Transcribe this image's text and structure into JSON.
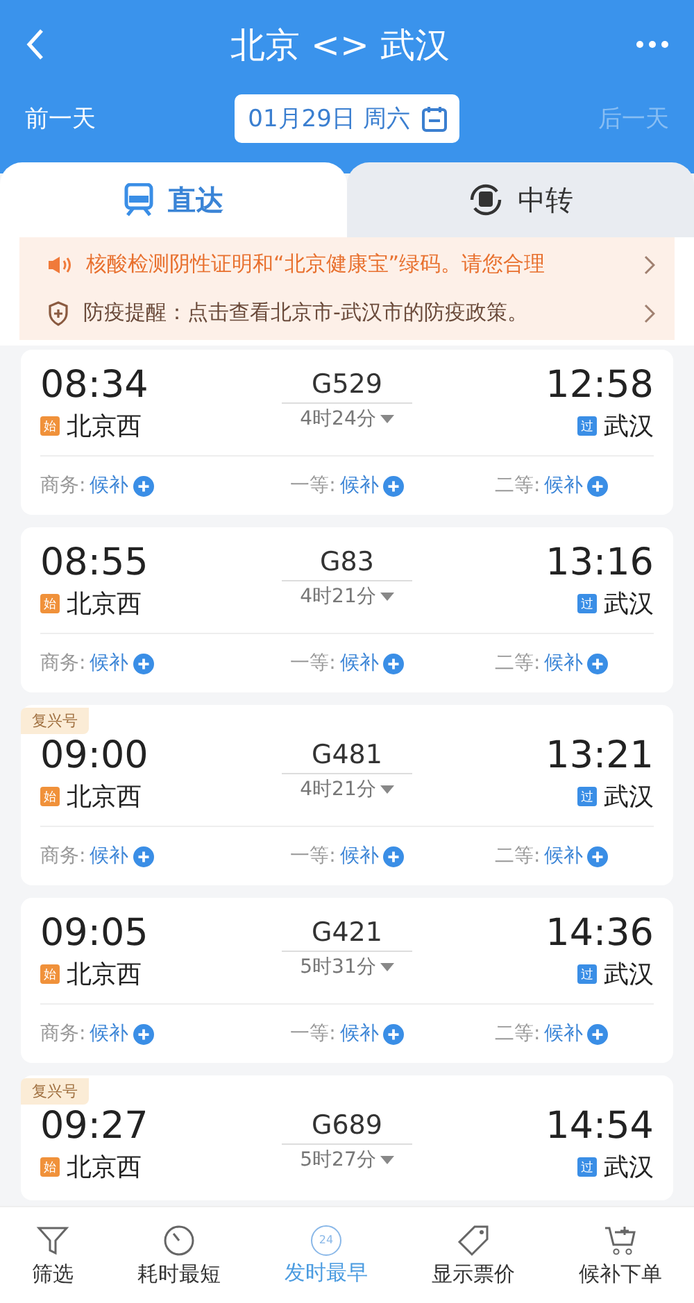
{
  "header": {
    "title": "北京 <> 武汉",
    "prev_day": "前一天",
    "date": "01月29日 周六",
    "next_day": "后一天",
    "next_day_disabled": true
  },
  "tabs": [
    {
      "label": "直达",
      "kind": "direct",
      "selected": true
    },
    {
      "label": "中转",
      "kind": "transfer",
      "selected": false
    }
  ],
  "notices": [
    {
      "kind": "speaker",
      "text": "核酸检测阴性证明和“北京健康宝”绿码。请您合理"
    },
    {
      "kind": "shield",
      "text": "防疫提醒：点击查看北京市-武汉市的防疫政策。"
    }
  ],
  "trains": [
    {
      "depart": "08:34",
      "origin": {
        "badge": "始",
        "color": "#f0913a",
        "name": "北京西"
      },
      "number": "G529",
      "duration": "4时24分",
      "arrive": "12:58",
      "destination": {
        "badge": "过",
        "color": "#3a8ee6",
        "name": "武汉"
      },
      "seats": [
        {
          "class": "商务:",
          "status": "候补"
        },
        {
          "class": "一等:",
          "status": "候补"
        },
        {
          "class": "二等:",
          "status": "候补"
        }
      ]
    },
    {
      "depart": "08:55",
      "origin": {
        "badge": "始",
        "color": "#f0913a",
        "name": "北京西"
      },
      "number": "G83",
      "duration": "4时21分",
      "arrive": "13:16",
      "destination": {
        "badge": "过",
        "color": "#3a8ee6",
        "name": "武汉"
      },
      "seats": [
        {
          "class": "商务:",
          "status": "候补"
        },
        {
          "class": "一等:",
          "status": "候补"
        },
        {
          "class": "二等:",
          "status": "候补"
        }
      ]
    },
    {
      "tag": "复兴号",
      "depart": "09:00",
      "origin": {
        "badge": "始",
        "color": "#f0913a",
        "name": "北京西"
      },
      "number": "G481",
      "duration": "4时21分",
      "arrive": "13:21",
      "destination": {
        "badge": "过",
        "color": "#3a8ee6",
        "name": "武汉"
      },
      "seats": [
        {
          "class": "商务:",
          "status": "候补"
        },
        {
          "class": "一等:",
          "status": "候补"
        },
        {
          "class": "二等:",
          "status": "候补"
        }
      ]
    },
    {
      "depart": "09:05",
      "origin": {
        "badge": "始",
        "color": "#f0913a",
        "name": "北京西"
      },
      "number": "G421",
      "duration": "5时31分",
      "arrive": "14:36",
      "destination": {
        "badge": "过",
        "color": "#3a8ee6",
        "name": "武汉"
      },
      "seats": [
        {
          "class": "商务:",
          "status": "候补"
        },
        {
          "class": "一等:",
          "status": "候补"
        },
        {
          "class": "二等:",
          "status": "候补"
        }
      ]
    },
    {
      "tag": "复兴号",
      "depart": "09:27",
      "origin": {
        "badge": "始",
        "color": "#f0913a",
        "name": "北京西"
      },
      "number": "G689",
      "duration": "5时27分",
      "arrive": "14:54",
      "destination": {
        "badge": "过",
        "color": "#3a8ee6",
        "name": "武汉"
      }
    }
  ],
  "bottom_nav": [
    {
      "kind": "filter",
      "label": "筛选",
      "selected": false
    },
    {
      "kind": "timer",
      "label": "耗时最短",
      "selected": false
    },
    {
      "kind": "clock24",
      "label": "发时最早",
      "icon_text": "24",
      "selected": true
    },
    {
      "kind": "tag",
      "label": "显示票价",
      "selected": false
    },
    {
      "kind": "cart",
      "label": "候补下单",
      "selected": false
    }
  ]
}
